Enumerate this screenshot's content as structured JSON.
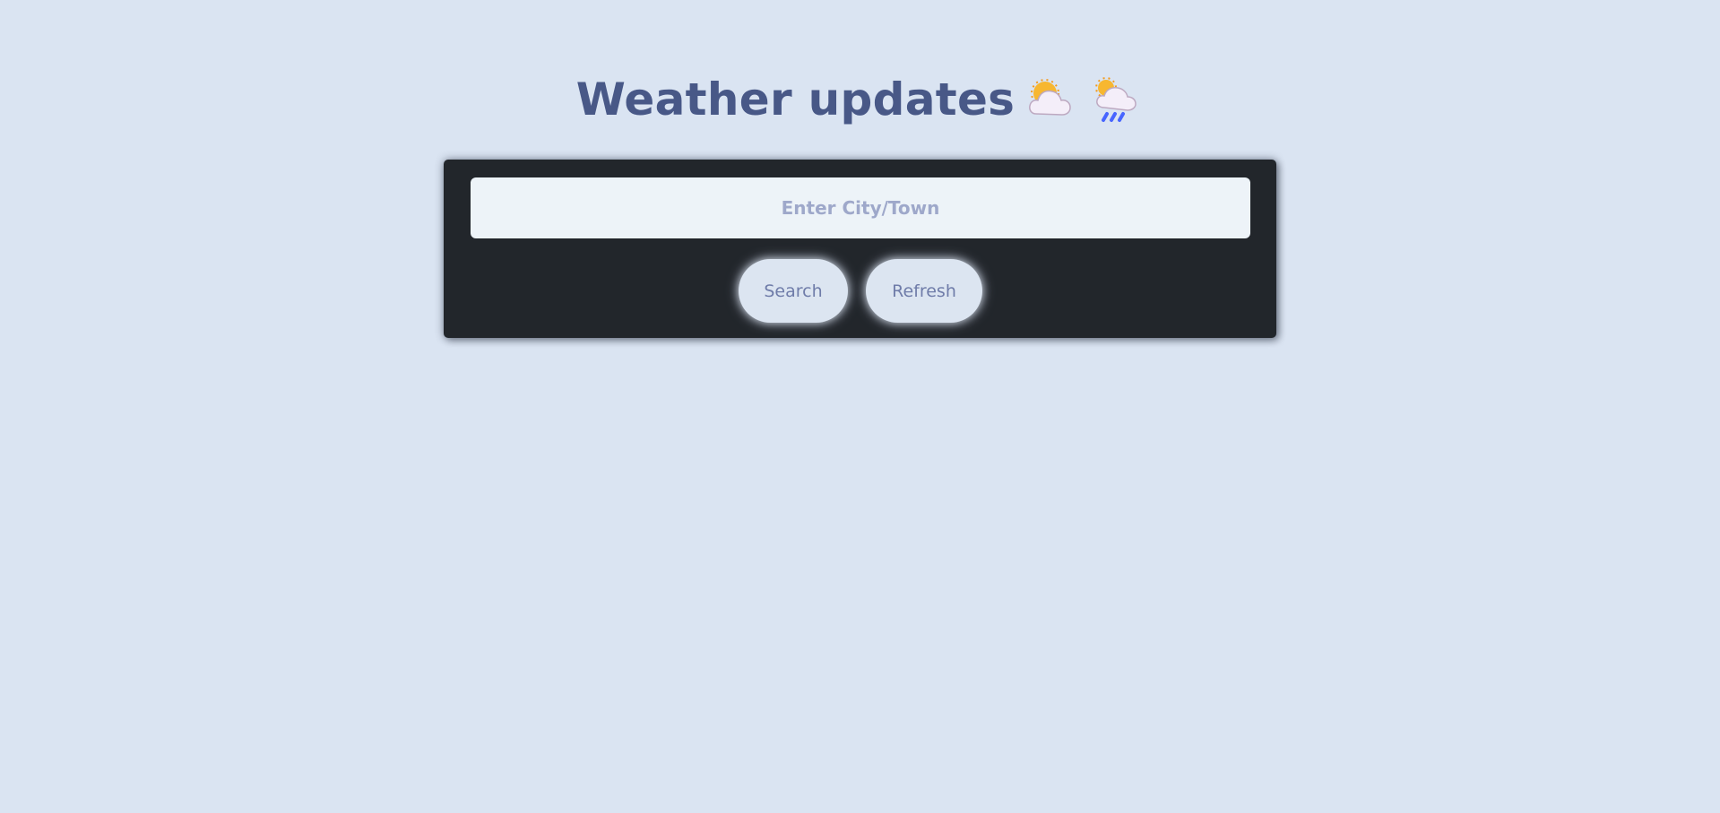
{
  "header": {
    "title": "Weather updates",
    "icons": [
      "sun-behind-cloud-icon",
      "sun-behind-rain-cloud-icon"
    ]
  },
  "search": {
    "placeholder": "Enter City/Town",
    "value": ""
  },
  "actions": {
    "search_label": "Search",
    "refresh_label": "Refresh"
  },
  "colors": {
    "background": "#dae4f2",
    "title": "#485887",
    "panel": "#22262b",
    "input_background": "#edf3f8",
    "button_background": "#dce5f1",
    "button_text": "#6f7ca9",
    "sun": "#f7b731",
    "rain": "#4765ff"
  }
}
